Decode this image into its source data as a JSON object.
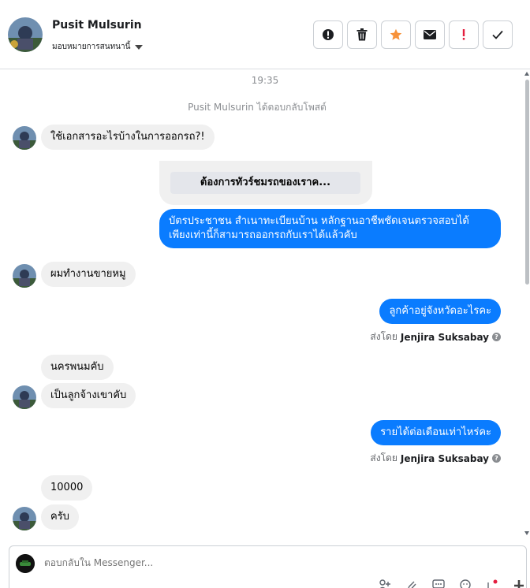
{
  "header": {
    "contact_name": "Pusit Mulsurin",
    "assign_label": "มอบหมายการสนทนานี้",
    "actions": [
      {
        "name": "spam-button",
        "icon": "alert-circle-icon"
      },
      {
        "name": "delete-button",
        "icon": "trash-icon"
      },
      {
        "name": "star-button",
        "icon": "star-icon",
        "color": "#f7923b"
      },
      {
        "name": "unread-button",
        "icon": "envelope-icon"
      },
      {
        "name": "follow-up-button",
        "icon": "exclamation-icon",
        "color": "#e41e3f"
      },
      {
        "name": "done-button",
        "icon": "check-icon"
      }
    ]
  },
  "thread": {
    "timestamp": "19:35",
    "system_message": "Pusit Mulsurin ได้ตอบกลับโพสต์",
    "card_button": "ต้องการทัวร์ชมรถของเราค...",
    "messages": {
      "m1": "ใช้เอกสารอะไรบ้างในการออกรถ?!",
      "m2_line1": "บัตรประชาชน สำเนาทะเบียนบ้าน หลักฐานอาชีพชัดเจนตรวจสอบได้",
      "m2_line2": "เพียงเท่านี้ก็สามารถออกรถกับเราได้แล้วคับ",
      "m3": "ผมทำงานขายหมู",
      "m4": "ลูกค้าอยู่จังหวัดอะไรคะ",
      "m5": "นครพนมคับ",
      "m6": "เป็นลูกจ้างเขาคับ",
      "m7": "รายได้ต่อเดือนเท่าไหร่คะ",
      "m8": "10000",
      "m9": "ครับ"
    },
    "sent_by_prefix": "ส่งโดย",
    "sent_by_name": "Jenjira Suksabay"
  },
  "composer": {
    "placeholder": "ตอบกลับใน Messenger..."
  },
  "colors": {
    "outgoing_bubble": "#0a7cff",
    "incoming_bubble": "#f0f0f0"
  }
}
